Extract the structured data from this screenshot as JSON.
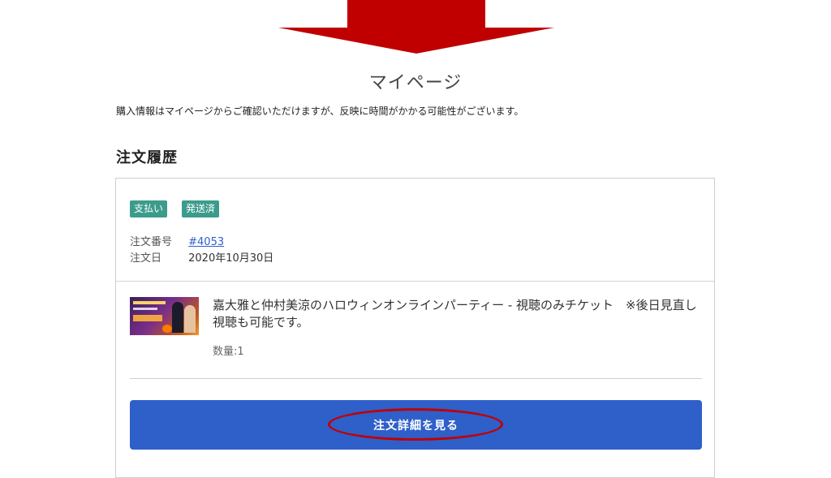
{
  "annotation": {
    "arrow_color": "#c00000",
    "highlight_color": "#c00000"
  },
  "page": {
    "title": "マイページ",
    "notice": "購入情報はマイページからご確認いただけますが、反映に時間がかかる可能性がございます。"
  },
  "order_history": {
    "heading": "注文履歴",
    "badges": [
      "支払い",
      "発送済"
    ],
    "badge_color": "#3c9c8c",
    "order_number_label": "注文番号",
    "order_number": "#4053",
    "order_date_label": "注文日",
    "order_date": "2020年10月30日",
    "item": {
      "thumbnail_icon": "event-banner-image",
      "title": "嘉大雅と仲村美涼のハロウィンオンラインパーティー - 視聴のみチケット　※後日見直し視聴も可能です。",
      "quantity": "数量:1"
    },
    "detail_button_label": "注文詳細を見る",
    "button_color": "#2f5fc9"
  }
}
